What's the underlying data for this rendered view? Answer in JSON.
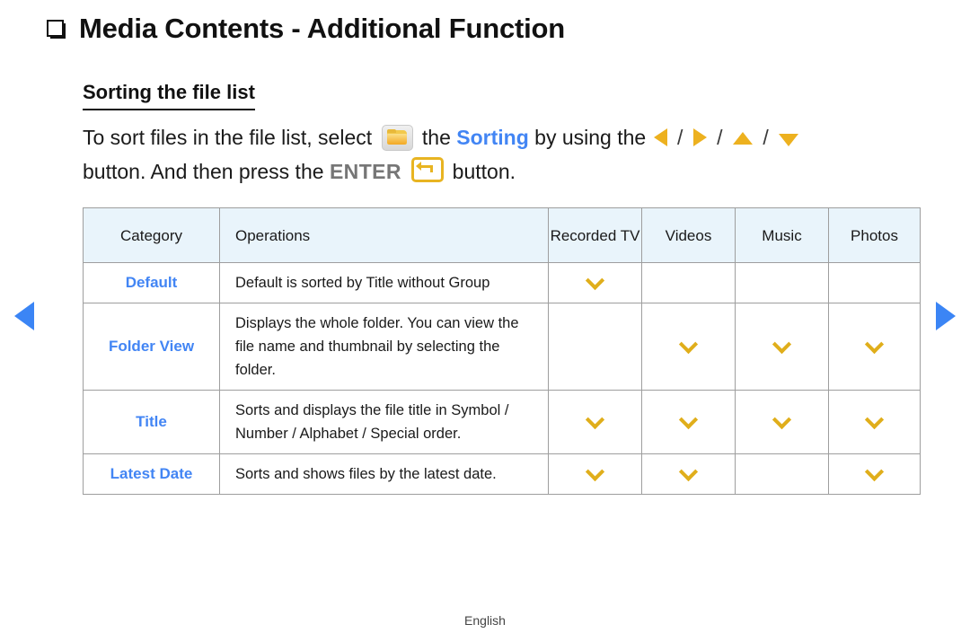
{
  "page": {
    "title": "Media Contents - Additional Function",
    "bullet_icon": "square-bullet-icon",
    "section_heading": "Sorting the file list",
    "footer_language": "English"
  },
  "body": {
    "part1": "To sort files in the file list, select",
    "folder_icon": "folder-icon",
    "part2": "the",
    "highlight": "Sorting",
    "part3": "by using the",
    "arrow_left_icon": "arrow-left-icon",
    "arrow_right_icon": "arrow-right-icon",
    "arrow_up_icon": "arrow-up-icon",
    "arrow_down_icon": "arrow-down-icon",
    "separator": "/",
    "part4": "button. And then press the",
    "enter_label": "ENTER",
    "enter_icon": "enter-key-icon",
    "part5": "button."
  },
  "navigation": {
    "prev_icon": "nav-previous-arrow-icon",
    "next_icon": "nav-next-arrow-icon"
  },
  "table": {
    "headers": {
      "category": "Category",
      "operations": "Operations",
      "recorded_tv": "Recorded TV",
      "videos": "Videos",
      "music": "Music",
      "photos": "Photos"
    },
    "rows": [
      {
        "category": "Default",
        "operations": "Default is sorted by Title without Group",
        "recorded_tv": true,
        "videos": false,
        "music": false,
        "photos": false
      },
      {
        "category": "Folder View",
        "operations": "Displays the whole folder. You can view the file name and thumbnail by selecting the folder.",
        "recorded_tv": false,
        "videos": true,
        "music": true,
        "photos": true
      },
      {
        "category": "Title",
        "operations": "Sorts and displays the file title in Symbol / Number / Alphabet / Special order.",
        "recorded_tv": true,
        "videos": true,
        "music": true,
        "photos": true
      },
      {
        "category": "Latest Date",
        "operations": "Sorts and shows files by the latest date.",
        "recorded_tv": true,
        "videos": true,
        "music": false,
        "photos": true
      }
    ]
  },
  "colors": {
    "accent_blue": "#4285f4",
    "accent_gold": "#e0ae1b",
    "header_bg": "#e9f4fb",
    "nav_blue": "#3b85f5",
    "enter_gray": "#767676"
  }
}
